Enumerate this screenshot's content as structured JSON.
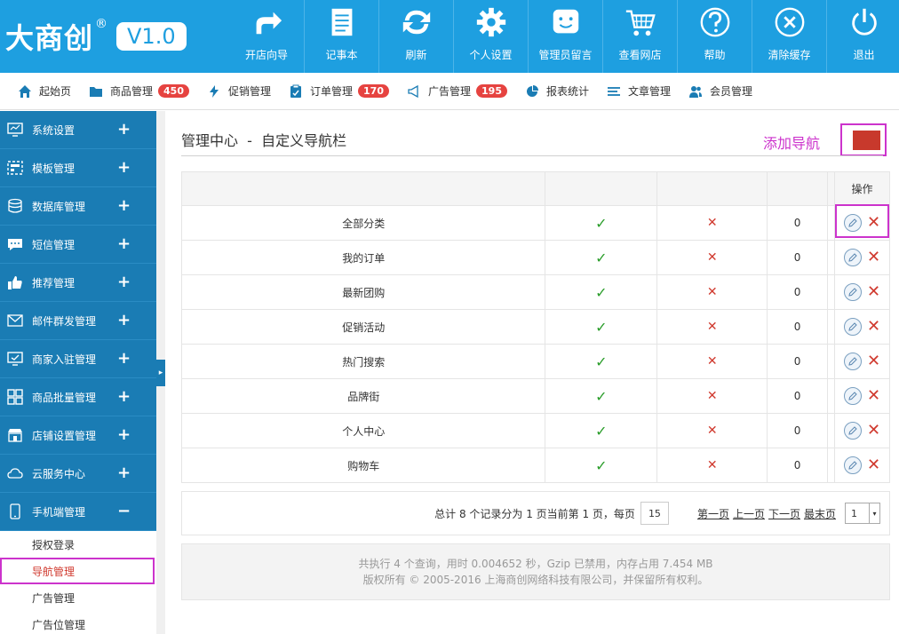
{
  "logo": {
    "text": "大商创",
    "reg": "®",
    "version": "V1.0"
  },
  "topnav": [
    {
      "label": "开店向导",
      "icon": "share-arrow-icon"
    },
    {
      "label": "记事本",
      "icon": "notepad-icon"
    },
    {
      "label": "刷新",
      "icon": "refresh-icon"
    },
    {
      "label": "个人设置",
      "icon": "gear-icon"
    },
    {
      "label": "管理员留言",
      "icon": "smiley-message-icon"
    },
    {
      "label": "查看网店",
      "icon": "cart-icon"
    },
    {
      "label": "帮助",
      "icon": "help-icon"
    },
    {
      "label": "清除缓存",
      "icon": "clear-x-icon"
    },
    {
      "label": "退出",
      "icon": "power-icon"
    }
  ],
  "subnav": [
    {
      "label": "起始页",
      "icon": "home-icon",
      "badge": ""
    },
    {
      "label": "商品管理",
      "icon": "folder-icon",
      "badge": "450"
    },
    {
      "label": "促销管理",
      "icon": "lightning-icon",
      "badge": ""
    },
    {
      "label": "订单管理",
      "icon": "clipboard-icon",
      "badge": "170"
    },
    {
      "label": "广告管理",
      "icon": "megaphone-icon",
      "badge": "195"
    },
    {
      "label": "报表统计",
      "icon": "pie-chart-icon",
      "badge": ""
    },
    {
      "label": "文章管理",
      "icon": "list-icon",
      "badge": ""
    },
    {
      "label": "会员管理",
      "icon": "users-icon",
      "badge": ""
    }
  ],
  "sidebar": {
    "items": [
      {
        "label": "系统设置",
        "icon": "monitor-icon",
        "toggle": "+"
      },
      {
        "label": "模板管理",
        "icon": "template-icon",
        "toggle": "+"
      },
      {
        "label": "数据库管理",
        "icon": "database-icon",
        "toggle": "+"
      },
      {
        "label": "短信管理",
        "icon": "chat-icon",
        "toggle": "+"
      },
      {
        "label": "推荐管理",
        "icon": "thumbs-up-icon",
        "toggle": "+"
      },
      {
        "label": "邮件群发管理",
        "icon": "envelope-icon",
        "toggle": "+"
      },
      {
        "label": "商家入驻管理",
        "icon": "monitor-check-icon",
        "toggle": "+"
      },
      {
        "label": "商品批量管理",
        "icon": "grid-icon",
        "toggle": "+"
      },
      {
        "label": "店铺设置管理",
        "icon": "shop-icon",
        "toggle": "+"
      },
      {
        "label": "云服务中心",
        "icon": "cloud-icon",
        "toggle": "+"
      },
      {
        "label": "手机端管理",
        "icon": "phone-icon",
        "toggle": "−"
      }
    ],
    "subitems": [
      {
        "label": "授权登录",
        "active": false
      },
      {
        "label": "导航管理",
        "active": true
      },
      {
        "label": "广告管理",
        "active": false
      },
      {
        "label": "广告位管理",
        "active": false
      }
    ],
    "toggle_glyph": "▸"
  },
  "main": {
    "title": "管理中心  -  自定义导航栏",
    "add_nav_label": "添加导航",
    "table": {
      "headers": [
        "",
        "",
        "",
        "",
        "",
        "操作"
      ],
      "rows": [
        {
          "name": "全部分类",
          "col2": "✓",
          "col3": "✕",
          "col4": "0"
        },
        {
          "name": "我的订单",
          "col2": "✓",
          "col3": "✕",
          "col4": "0"
        },
        {
          "name": "最新团购",
          "col2": "✓",
          "col3": "✕",
          "col4": "0"
        },
        {
          "name": "促销活动",
          "col2": "✓",
          "col3": "✕",
          "col4": "0"
        },
        {
          "name": "热门搜索",
          "col2": "✓",
          "col3": "✕",
          "col4": "0"
        },
        {
          "name": "品牌街",
          "col2": "✓",
          "col3": "✕",
          "col4": "0"
        },
        {
          "name": "个人中心",
          "col2": "✓",
          "col3": "✕",
          "col4": "0"
        },
        {
          "name": "购物车",
          "col2": "✓",
          "col3": "✕",
          "col4": "0"
        }
      ],
      "delete_glyph": "✕"
    },
    "pager": {
      "summary": "总计 8 个记录分为 1 页当前第 1 页，每页",
      "per_page": "15",
      "first": "第一页",
      "prev": "上一页",
      "next": "下一页",
      "last": "最末页",
      "page_select": "1",
      "select_arrow": "▾"
    },
    "footer": {
      "line1": "共执行 4 个查询，用时 0.004652 秒，Gzip 已禁用，内存占用 7.454 MB",
      "line2": "版权所有 © 2005-2016 上海商创网络科技有限公司，并保留所有权利。"
    }
  },
  "colors": {
    "brand_blue": "#1e9fe0",
    "sidebar_blue": "#1a7cb4",
    "badge_red": "#e64340",
    "highlight_magenta": "#cc33cc",
    "check_green": "#2a9d2a",
    "cross_red": "#d03a2f"
  }
}
